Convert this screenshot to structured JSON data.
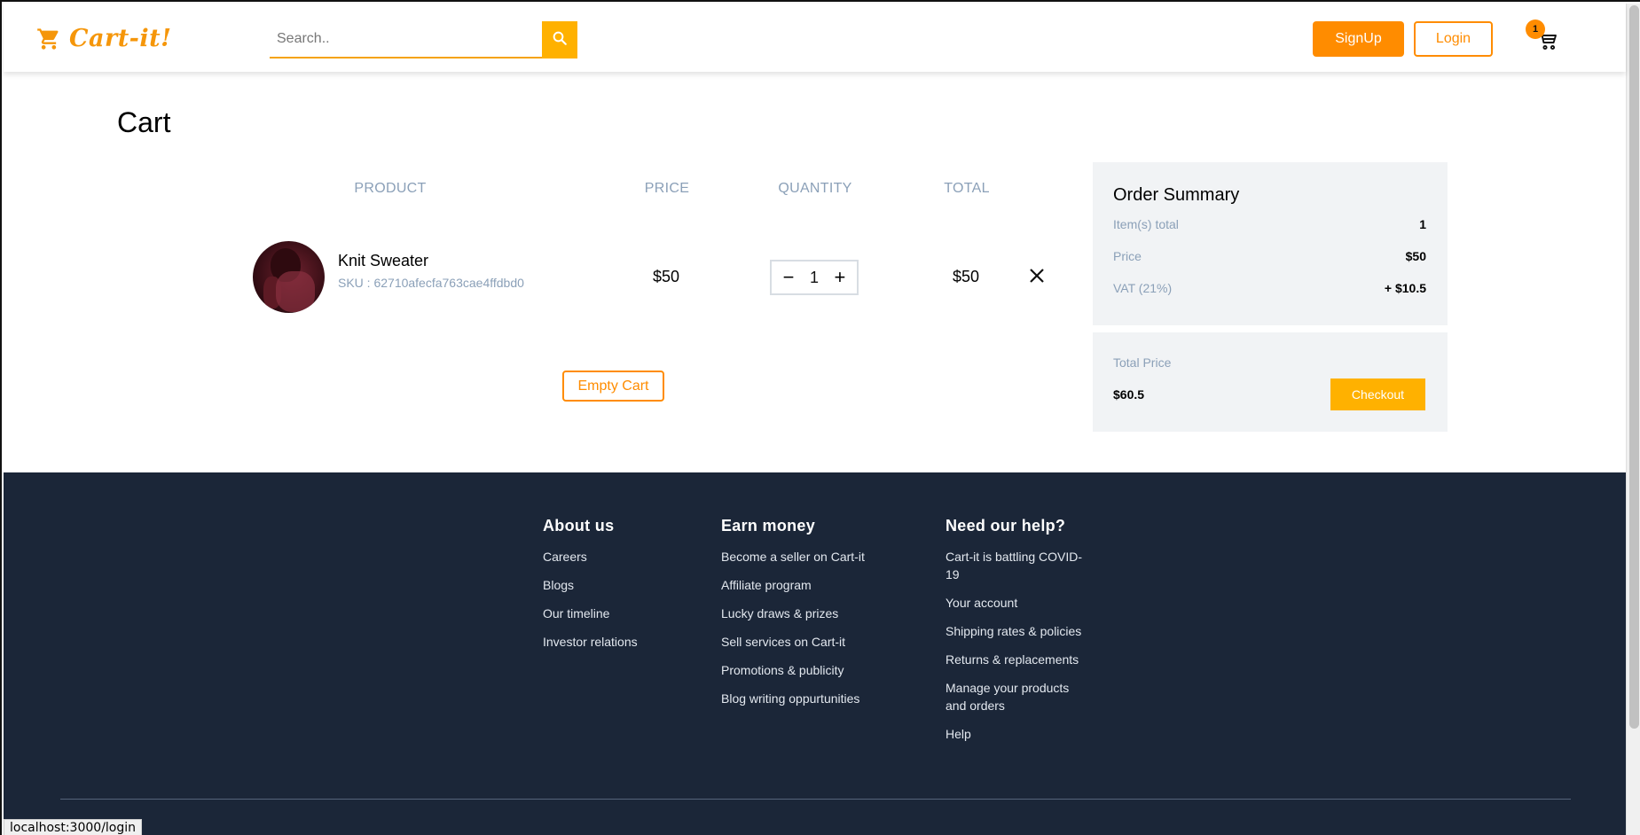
{
  "app": {
    "logo_text": "Cart-it!",
    "accent_color": "#ff8c00",
    "accent_light": "#ffb100",
    "footer_bg": "#1b2638"
  },
  "header": {
    "search_placeholder": "Search..",
    "signup_label": "SignUp",
    "login_label": "Login",
    "cart_count": "1",
    "icons": {
      "logo": "shopping-cart-icon",
      "search": "search-icon",
      "cart": "cart-icon"
    }
  },
  "cart": {
    "title": "Cart",
    "columns": [
      "PRODUCT",
      "PRICE",
      "QUANTITY",
      "TOTAL"
    ],
    "items": [
      {
        "name": "Knit Sweater",
        "sku": "SKU : 62710afecfa763cae4ffdbd0",
        "price": "$50",
        "quantity": "1",
        "total": "$50"
      }
    ],
    "qty_minus": "−",
    "qty_plus": "+",
    "empty_cart_label": "Empty Cart"
  },
  "summary": {
    "title": "Order Summary",
    "rows": [
      {
        "label": "Item(s) total",
        "value": "1"
      },
      {
        "label": "Price",
        "value": "$50"
      },
      {
        "label": "VAT (21%)",
        "value": "+ $10.5"
      }
    ],
    "total_label": "Total Price",
    "total_value": "$60.5",
    "checkout_label": "Checkout"
  },
  "footer": {
    "columns": [
      {
        "title": "About us",
        "links": [
          "Careers",
          "Blogs",
          "Our timeline",
          "Investor relations"
        ]
      },
      {
        "title": "Earn money",
        "links": [
          "Become a seller on Cart-it",
          "Affiliate program",
          "Lucky draws & prizes",
          "Sell services on Cart-it",
          "Promotions & publicity",
          "Blog writing oppurtunities"
        ]
      },
      {
        "title": "Need our help?",
        "links": [
          "Cart-it is battling COVID-19",
          "Your account",
          "Shipping rates & policies",
          "Returns & replacements",
          "Manage your products and orders",
          "Help"
        ]
      }
    ]
  },
  "status_bar": {
    "url": "localhost:3000/login"
  }
}
